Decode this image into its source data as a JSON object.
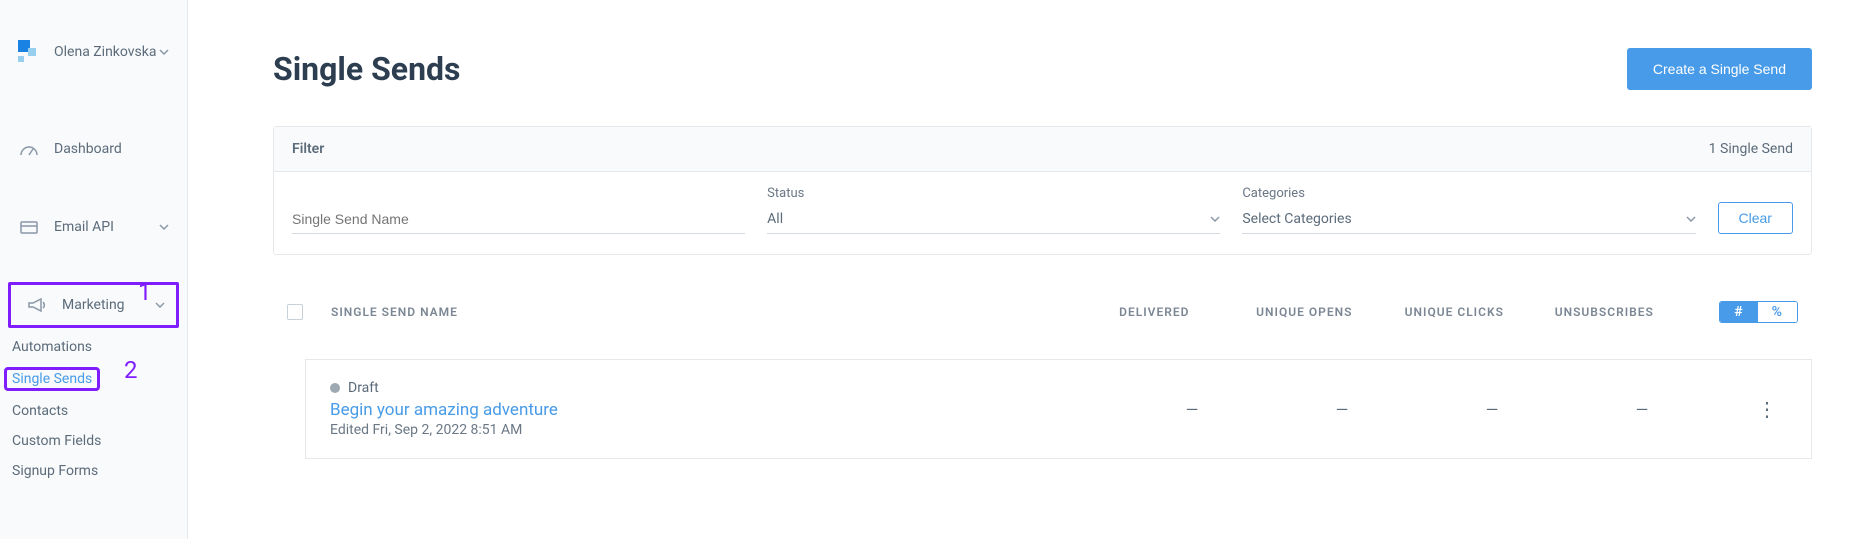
{
  "user": {
    "name": "Olena Zinkovska"
  },
  "nav": {
    "dashboard": "Dashboard",
    "emailApi": "Email API",
    "marketing": "Marketing",
    "sub": {
      "automations": "Automations",
      "singleSends": "Single Sends",
      "contacts": "Contacts",
      "customFields": "Custom Fields",
      "signupForms": "Signup Forms"
    }
  },
  "annotations": {
    "one": "1",
    "two": "2"
  },
  "page": {
    "title": "Single Sends",
    "createBtn": "Create a Single Send"
  },
  "filter": {
    "title": "Filter",
    "count": "1 Single Send",
    "namePlaceholder": "Single Send Name",
    "statusLabel": "Status",
    "statusValue": "All",
    "categoriesLabel": "Categories",
    "categoriesValue": "Select Categories",
    "clearBtn": "Clear"
  },
  "table": {
    "headers": {
      "name": "Single Send Name",
      "delivered": "Delivered",
      "opens": "Unique Opens",
      "clicks": "Unique Clicks",
      "unsubscribes": "Unsubscribes"
    },
    "toggle": {
      "hash": "#",
      "percent": "%"
    }
  },
  "rows": [
    {
      "status": "Draft",
      "title": "Begin your amazing adventure",
      "meta": "Edited Fri, Sep 2, 2022 8:51 AM",
      "delivered": "—",
      "opens": "—",
      "clicks": "—",
      "unsubscribes": "—"
    }
  ]
}
